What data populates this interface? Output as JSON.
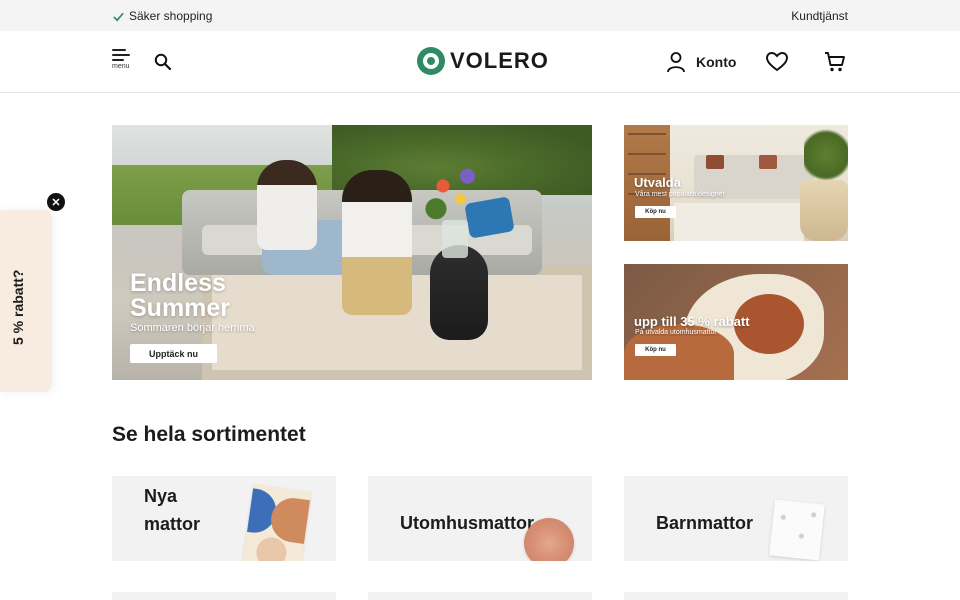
{
  "topbar": {
    "secure_label": "Säker shopping",
    "service_label": "Kundtjänst"
  },
  "header": {
    "menu_label": "menu",
    "logo_text": "VOLERO",
    "account_label": "Konto",
    "icons": {
      "menu": "hamburger-icon",
      "search": "search-icon",
      "account": "user-icon",
      "wishlist": "heart-icon",
      "cart": "cart-icon"
    }
  },
  "hero": {
    "title_line1": "Endless",
    "title_line2": "Summer",
    "subtitle": "Sommaren börjar hemma",
    "cta": "Upptäck nu"
  },
  "promos": [
    {
      "title": "Utvalda",
      "subtitle": "Våra mest populära designer",
      "cta": "Köp nu"
    },
    {
      "title": "upp till 35 % rabatt",
      "subtitle": "På utvalda utomhusmattor",
      "cta": "Köp nu"
    }
  ],
  "section": {
    "title": "Se hela sortimentet"
  },
  "categories": [
    {
      "label": "Nya mattor"
    },
    {
      "label": "Utomhusmattor"
    },
    {
      "label": "Barnmattor"
    }
  ],
  "side_tab": {
    "label": "5 % rabatt?",
    "close": "✕"
  },
  "colors": {
    "brand": "#2f8a66",
    "topbar_bg": "#f3f4f3",
    "card_bg": "#f2f2f2",
    "side_tab_bg": "#f7ecdf"
  }
}
